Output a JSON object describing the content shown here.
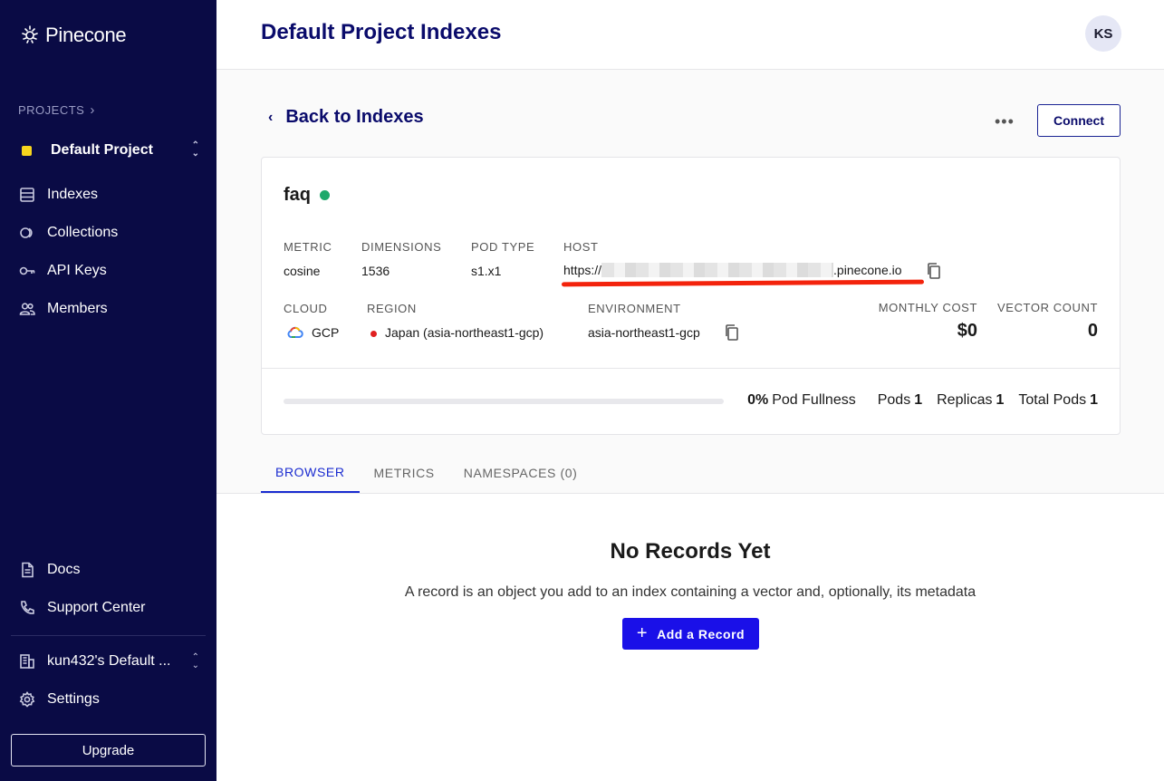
{
  "sidebar": {
    "brand": "Pinecone",
    "projects_label": "PROJECTS",
    "project_name": "Default Project",
    "nav": [
      {
        "label": "Indexes",
        "icon": "database-icon"
      },
      {
        "label": "Collections",
        "icon": "collections-icon"
      },
      {
        "label": "API Keys",
        "icon": "key-icon"
      },
      {
        "label": "Members",
        "icon": "members-icon"
      }
    ],
    "bottom_nav": [
      {
        "label": "Docs",
        "icon": "document-icon"
      },
      {
        "label": "Support Center",
        "icon": "phone-icon"
      }
    ],
    "org_name": "kun432's Default ...",
    "settings_label": "Settings",
    "upgrade_label": "Upgrade",
    "colors": {
      "background": "#0a0b45",
      "project_accent": "#f7d51d"
    }
  },
  "header": {
    "title": "Default Project Indexes",
    "avatar_initials": "KS"
  },
  "main": {
    "back_label": "Back to Indexes",
    "more_label": "•••",
    "connect_label": "Connect",
    "index": {
      "name": "faq",
      "status_color": "#1ea96b",
      "metric_label": "METRIC",
      "metric": "cosine",
      "dimensions_label": "DIMENSIONS",
      "dimensions": "1536",
      "pod_type_label": "POD TYPE",
      "pod_type": "s1.x1",
      "host_label": "HOST",
      "host_prefix": "https://",
      "host_suffix": ".pinecone.io",
      "cloud_label": "CLOUD",
      "cloud": "GCP",
      "region_label": "REGION",
      "region": "Japan (asia-northeast1-gcp)",
      "environment_label": "ENVIRONMENT",
      "environment": "asia-northeast1-gcp",
      "monthly_cost_label": "MONTHLY COST",
      "monthly_cost": "$0",
      "vector_count_label": "VECTOR COUNT",
      "vector_count": "0",
      "pod_fullness_percent": 0,
      "pod_fullness_value": "0%",
      "pod_fullness_label": "Pod Fullness",
      "pods_label": "Pods",
      "pods": "1",
      "replicas_label": "Replicas",
      "replicas": "1",
      "total_pods_label": "Total Pods",
      "total_pods": "1"
    },
    "tabs": [
      {
        "label": "BROWSER",
        "active": true
      },
      {
        "label": "METRICS",
        "active": false
      },
      {
        "label": "NAMESPACES (0)",
        "active": false
      }
    ],
    "empty": {
      "title": "No Records Yet",
      "description": "A record is an object you add to an index containing a vector and, optionally, its metadata",
      "add_label": "Add a Record"
    }
  }
}
